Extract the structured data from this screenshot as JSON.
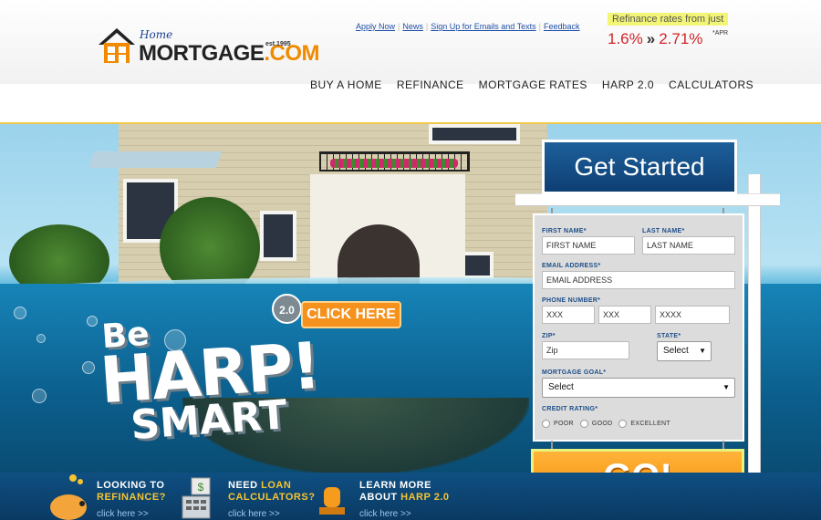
{
  "header": {
    "logo": {
      "script": "Home",
      "brand": "MORTGAGE",
      "tld": ".COM",
      "est": "est.1995"
    },
    "top_links": [
      "Apply Now",
      "News",
      "Sign Up for Emails and Texts",
      "Feedback"
    ],
    "rates": {
      "label": "Refinance rates from just",
      "low": "1.6%",
      "arrow": "»",
      "high": "2.71%",
      "apr": "*APR"
    },
    "nav": [
      "BUY A HOME",
      "REFINANCE",
      "MORTGAGE RATES",
      "HARP 2.0",
      "CALCULATORS"
    ]
  },
  "hero": {
    "headline_be": "Be",
    "headline_harp": "HARP!",
    "headline_smart": "SMART",
    "badge": "2.0",
    "cta": "CLICK HERE"
  },
  "form": {
    "heading": "Get Started",
    "first_name_label": "FIRST NAME*",
    "first_name_placeholder": "FIRST NAME",
    "last_name_label": "LAST NAME*",
    "last_name_placeholder": "LAST NAME",
    "email_label": "EMAIL ADDRESS*",
    "email_placeholder": "EMAIL ADDRESS",
    "phone_label": "PHONE NUMBER*",
    "phone_area": "XXX",
    "phone_prefix": "XXX",
    "phone_line": "XXXX",
    "zip_label": "ZIP*",
    "zip_placeholder": "Zip",
    "state_label": "STATE*",
    "state_value": "Select",
    "goal_label": "MORTGAGE GOAL*",
    "goal_value": "Select",
    "credit_label": "CREDIT RATING*",
    "credit_options": [
      "POOR",
      "GOOD",
      "EXCELLENT"
    ],
    "submit": "GO!"
  },
  "promo": [
    {
      "line1": "LOOKING TO",
      "line2_highlight": "REFINANCE?",
      "link": "click here >>"
    },
    {
      "line1_plain": "NEED ",
      "line1_highlight": "LOAN",
      "line2_highlight": "CALCULATORS?",
      "link": "click here >>"
    },
    {
      "line1": "LEARN MORE",
      "line2_plain": "ABOUT ",
      "line2_highlight": "HARP 2.0",
      "link": "click here >>"
    }
  ],
  "colors": {
    "brand_blue": "#1d4e89",
    "accent_orange": "#f5921e",
    "rate_red": "#d2232a",
    "highlight_yellow": "#f3f576"
  }
}
